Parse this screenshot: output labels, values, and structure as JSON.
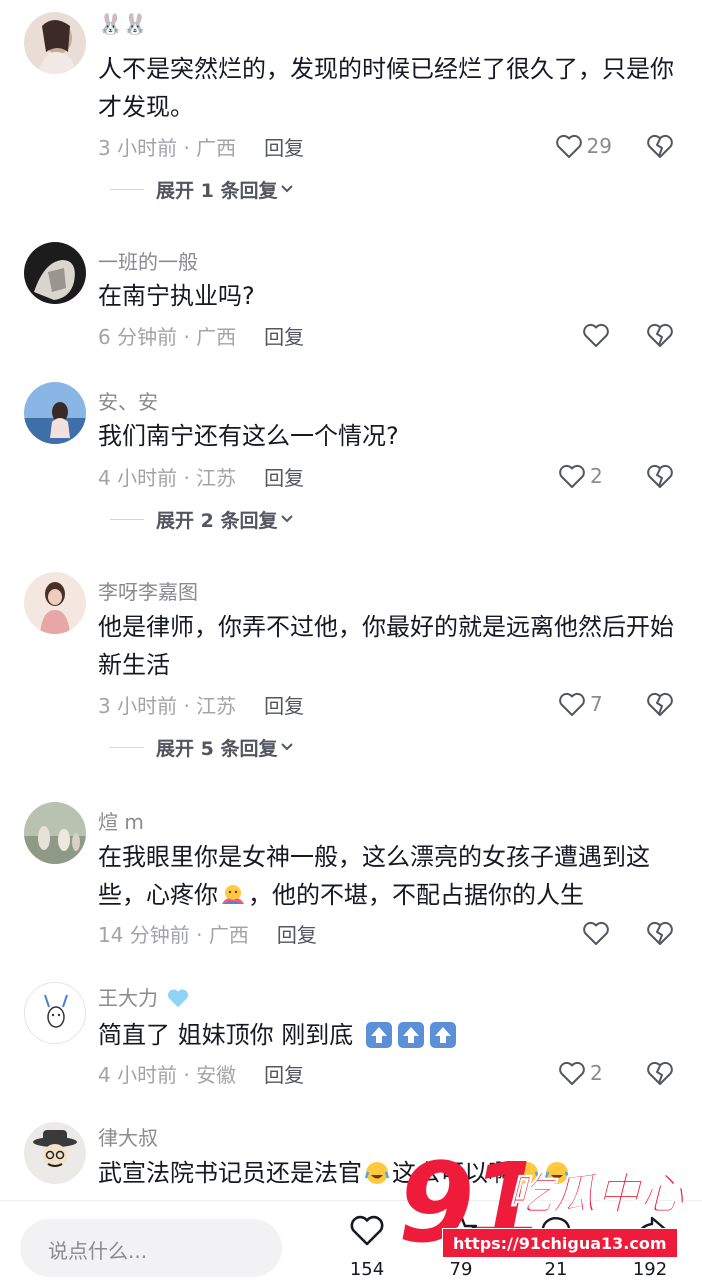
{
  "comments": [
    {
      "username": "🐰🐰",
      "text": "人不是突然烂的，发现的时候已经烂了很久了，只是你才发现。",
      "time_location": "3 小时前 · 广西",
      "reply_label": "回复",
      "likes": "29",
      "expand_label": "展开 1 条回复",
      "avatar_color": "#c9a89a"
    },
    {
      "username": "一班的一般",
      "text": "在南宁执业吗?",
      "time_location": "6 分钟前 · 广西",
      "reply_label": "回复",
      "likes": "",
      "avatar_color": "#2a2a2a"
    },
    {
      "username": "安、安",
      "text": "我们南宁还有这么一个情况?",
      "time_location": "4 小时前 · 江苏",
      "reply_label": "回复",
      "likes": "2",
      "expand_label": "展开 2 条回复",
      "avatar_color": "#6fa0d8"
    },
    {
      "username": "李呀李嘉图",
      "text": "他是律师，你弄不过他，你最好的就是远离他然后开始新生活",
      "time_location": "3 小时前 · 江苏",
      "reply_label": "回复",
      "likes": "7",
      "expand_label": "展开 5 条回复",
      "avatar_color": "#e6a7a6"
    },
    {
      "username": "煊 m",
      "text_a": "在我眼里你是女神一般，这么漂亮的女孩子遭遇到这些，心疼你",
      "text_b": "，他的不堪，不配占据你的人生",
      "time_location": "14 分钟前 · 广西",
      "reply_label": "回复",
      "likes": "",
      "avatar_color": "#8f9a86"
    },
    {
      "username": "王大力",
      "text": "简直了  姐妹顶你 刚到底",
      "time_location": "4 小时前 · 安徽",
      "reply_label": "回复",
      "likes": "2",
      "avatar_color": "#f4f4f6"
    },
    {
      "username": "律大叔",
      "text_a": "武宣法院书记员还是法官",
      "text_b": "这么可以啊",
      "avatar_color": "#eceae6"
    }
  ],
  "bottom_bar": {
    "input_placeholder": "说点什么...",
    "like_count": "154",
    "collect_count": "79",
    "comment_count": "21",
    "share_count": "192"
  },
  "watermark": {
    "number": "91",
    "name": "吃瓜中心",
    "url": "https://91chigua13.com"
  },
  "colors": {
    "accent": "#ee1c3a",
    "text_primary": "#161823",
    "text_secondary": "#8a8b91"
  }
}
